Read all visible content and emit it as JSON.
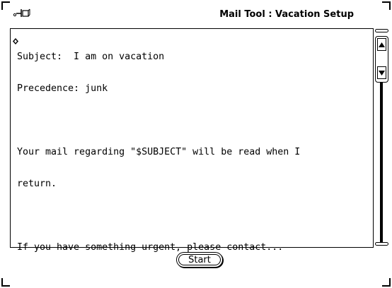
{
  "window": {
    "title": "Mail Tool : Vacation Setup"
  },
  "message": {
    "lines": [
      "Subject:  I am on vacation",
      "Precedence: junk",
      "",
      "Your mail regarding \"$SUBJECT\" will be read when I",
      "return.",
      "",
      "If you have something urgent, please contact..."
    ]
  },
  "buttons": {
    "start_label": "Start"
  },
  "icons": {
    "pushpin": "pushpin-icon",
    "caret": "text-caret-icon",
    "scroll_up": "scroll-up-arrow-icon",
    "scroll_down": "scroll-down-arrow-icon"
  }
}
